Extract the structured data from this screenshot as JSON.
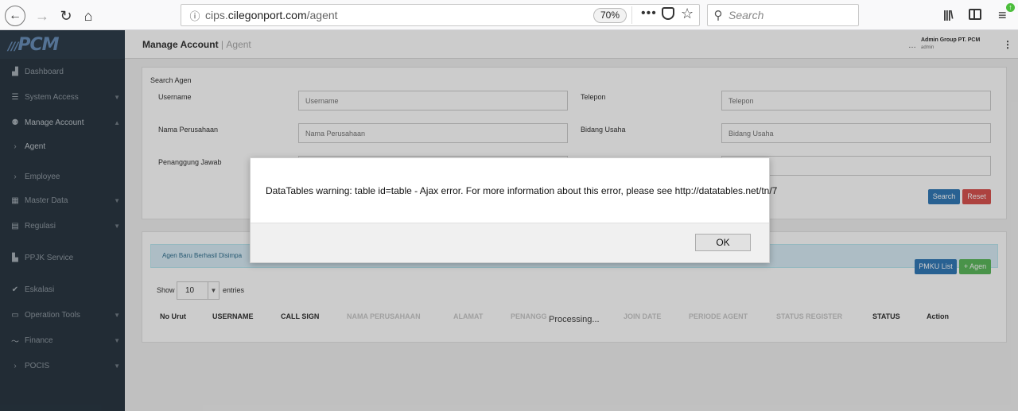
{
  "browser": {
    "url_prefix": "cips.",
    "url_domain": "cilegonport.com",
    "url_path": "/agent",
    "zoom": "70%",
    "search_placeholder": "Search"
  },
  "sidebar": {
    "logo": "PCM",
    "items": [
      {
        "label": "Dashboard",
        "icon": "dashboard-icon",
        "glyph": "▟"
      },
      {
        "label": "System Access",
        "icon": "sliders-icon",
        "glyph": "☰"
      },
      {
        "label": "Manage Account",
        "icon": "users-icon",
        "glyph": "⚉"
      },
      {
        "label": "Agent",
        "icon": "chevron-right-icon",
        "glyph": "›"
      },
      {
        "label": "Employee",
        "icon": "chevron-right-icon",
        "glyph": "›"
      },
      {
        "label": "Master Data",
        "icon": "table-icon",
        "glyph": "▦"
      },
      {
        "label": "Regulasi",
        "icon": "book-icon",
        "glyph": "▤"
      },
      {
        "label": "PPJK Service",
        "icon": "building-icon",
        "glyph": "▙"
      },
      {
        "label": "Eskalasi",
        "icon": "escalation-icon",
        "glyph": "✔"
      },
      {
        "label": "Operation Tools",
        "icon": "monitor-icon",
        "glyph": "▭"
      },
      {
        "label": "Finance",
        "icon": "chart-line-icon",
        "glyph": "〜"
      },
      {
        "label": "POCIS",
        "icon": "chevron-right-icon",
        "glyph": "›"
      }
    ]
  },
  "header": {
    "title": "Manage Account",
    "separator": "|",
    "subtitle": "Agent",
    "user_name": "Admin Group PT. PCM",
    "user_role": "admin"
  },
  "search_form": {
    "title": "Search Agen",
    "fields": [
      {
        "label": "Username",
        "placeholder": "Username"
      },
      {
        "label": "Telepon",
        "placeholder": "Telepon"
      },
      {
        "label": "Nama Perusahaan",
        "placeholder": "Nama Perusahaan"
      },
      {
        "label": "Bidang Usaha",
        "placeholder": "Bidang Usaha"
      },
      {
        "label": "Penanggung Jawab",
        "placeholder": ""
      }
    ],
    "search_button": "Search",
    "reset_button": "Reset"
  },
  "list": {
    "alert": "Agen Baru Berhasil Disimpa",
    "pmku_button": "PMKU List",
    "add_button": "+ Agen",
    "show_label": "Show",
    "length_value": "10",
    "entries_label": "entries",
    "columns": [
      "No Urut",
      "USERNAME",
      "CALL SIGN",
      "NAMA PERUSAHAAN",
      "ALAMAT",
      "PENANGG",
      "JOIN DATE",
      "PERIODE AGENT",
      "STATUS REGISTER",
      "STATUS",
      "Action"
    ],
    "processing": "Processing..."
  },
  "dialog": {
    "message": "DataTables warning: table id=table - Ajax error. For more information about this error, please see http://datatables.net/tn/7",
    "ok_label": "OK"
  }
}
